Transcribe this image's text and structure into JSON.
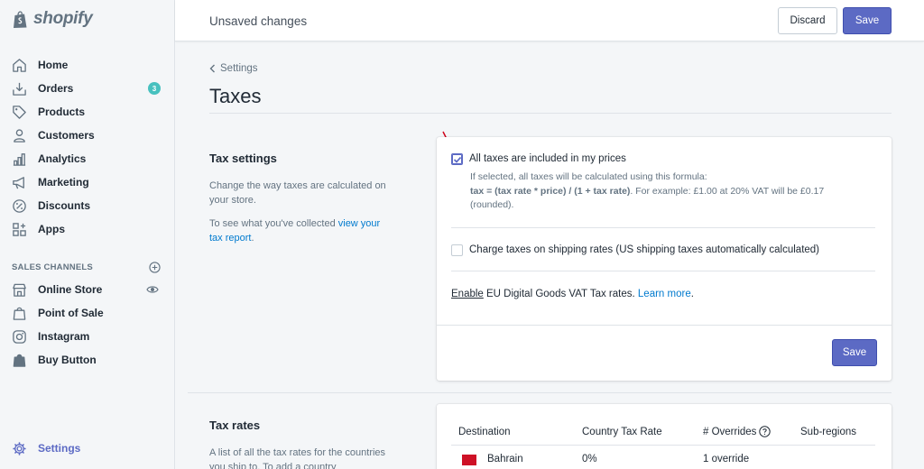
{
  "brand": {
    "name": "shopify"
  },
  "sidebar": {
    "items": [
      {
        "label": "Home",
        "icon": "home-icon"
      },
      {
        "label": "Orders",
        "icon": "orders-icon",
        "badge": "3"
      },
      {
        "label": "Products",
        "icon": "tag-icon"
      },
      {
        "label": "Customers",
        "icon": "person-icon"
      },
      {
        "label": "Analytics",
        "icon": "bar-chart-icon"
      },
      {
        "label": "Marketing",
        "icon": "megaphone-icon"
      },
      {
        "label": "Discounts",
        "icon": "discount-icon"
      },
      {
        "label": "Apps",
        "icon": "apps-icon"
      }
    ],
    "channels_heading": "SALES CHANNELS",
    "channels": [
      {
        "label": "Online Store",
        "icon": "store-icon"
      },
      {
        "label": "Point of Sale",
        "icon": "pos-icon"
      },
      {
        "label": "Instagram",
        "icon": "instagram-icon"
      },
      {
        "label": "Buy Button",
        "icon": "buy-button-icon"
      }
    ],
    "settings_label": "Settings"
  },
  "topbar": {
    "status": "Unsaved changes",
    "discard_label": "Discard",
    "save_label": "Save"
  },
  "breadcrumb": "Settings",
  "page_title": "Taxes",
  "tax_settings": {
    "title": "Tax settings",
    "desc": "Change the way taxes are calculated on your store.",
    "collected_prefix": "To see what you've collected ",
    "collected_link": "view your tax report",
    "collected_suffix": ".",
    "included_label": "All taxes are included in my prices",
    "included_checked": true,
    "help_line1": "If selected, all taxes will be calculated using this formula:",
    "help_formula": "tax = (tax rate * price) / (1 + tax rate)",
    "help_example": ". For example: £1.00 at 20% VAT will be £0.17 (rounded).",
    "shipping_label": "Charge taxes on shipping rates (US shipping taxes automatically calculated)",
    "shipping_checked": false,
    "enable_word": "Enable",
    "eu_text": " EU Digital Goods VAT Tax rates. ",
    "learn_more": "Learn more",
    "learn_suffix": ".",
    "save_label": "Save"
  },
  "tax_rates": {
    "title": "Tax rates",
    "desc": "A list of all the tax rates for the countries you ship to. To add a country",
    "columns": [
      "Destination",
      "Country Tax Rate",
      "# Overrides",
      "Sub-regions"
    ],
    "rows": [
      {
        "destination": "Bahrain",
        "rate": "0%",
        "overrides": "1 override",
        "subregions": ""
      }
    ]
  },
  "colors": {
    "accent": "#5c6ac4",
    "link": "#007ace",
    "badge": "#47c1bf",
    "arrow": "#d0021b"
  }
}
